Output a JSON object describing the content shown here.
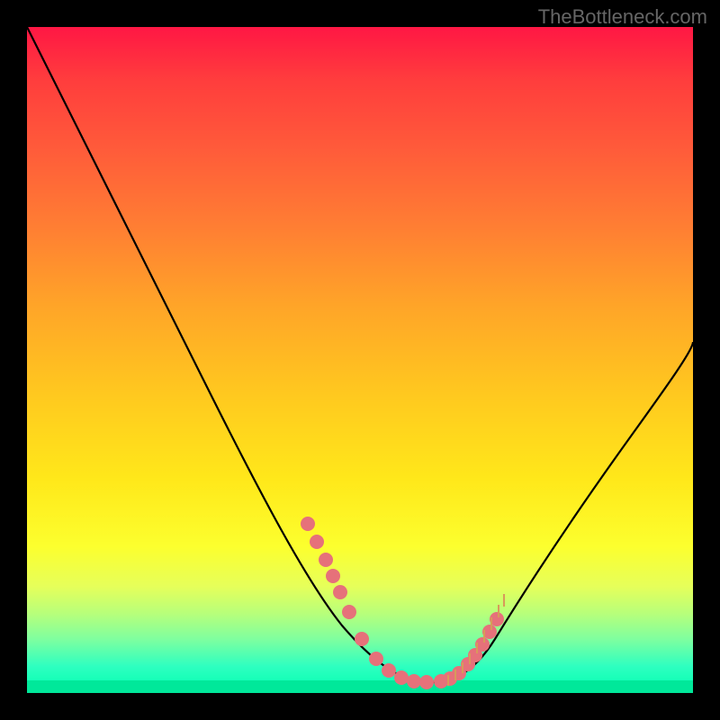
{
  "watermark": "TheBottleneck.com",
  "chart_data": {
    "type": "line",
    "title": "",
    "xlabel": "",
    "ylabel": "",
    "xlim": [
      0,
      100
    ],
    "ylim": [
      0,
      100
    ],
    "series": [
      {
        "name": "bottleneck-curve",
        "x": [
          0,
          5,
          10,
          15,
          20,
          25,
          30,
          35,
          40,
          45,
          48,
          50,
          52,
          55,
          58,
          60,
          63,
          67,
          70,
          75,
          80,
          85,
          90,
          95,
          100
        ],
        "values": [
          100,
          92,
          84,
          76,
          68,
          60,
          52,
          44,
          36,
          27,
          20,
          15,
          10,
          6,
          3,
          2,
          2,
          3,
          5,
          10,
          18,
          27,
          36,
          44,
          52
        ]
      }
    ],
    "markers_left": {
      "name": "left-branch-dots",
      "x": [
        42,
        43.5,
        45,
        46,
        47,
        48,
        50,
        52,
        54,
        56,
        58,
        60
      ],
      "y": [
        27,
        24,
        21,
        19,
        17,
        14,
        9,
        6,
        4,
        3,
        2.2,
        2
      ]
    },
    "markers_right": {
      "name": "right-branch-dots",
      "x": [
        62,
        63,
        64.5,
        66,
        67,
        68,
        69,
        70
      ],
      "y": [
        2,
        2.3,
        3,
        4.2,
        5.5,
        7,
        9,
        11
      ]
    },
    "ticks_right": {
      "name": "right-branch-ticks",
      "x": [
        63,
        64,
        65,
        66,
        67,
        68,
        69,
        70,
        71
      ],
      "y": [
        2.5,
        3,
        3.8,
        4.6,
        5.8,
        7.2,
        9,
        11,
        13
      ]
    }
  }
}
